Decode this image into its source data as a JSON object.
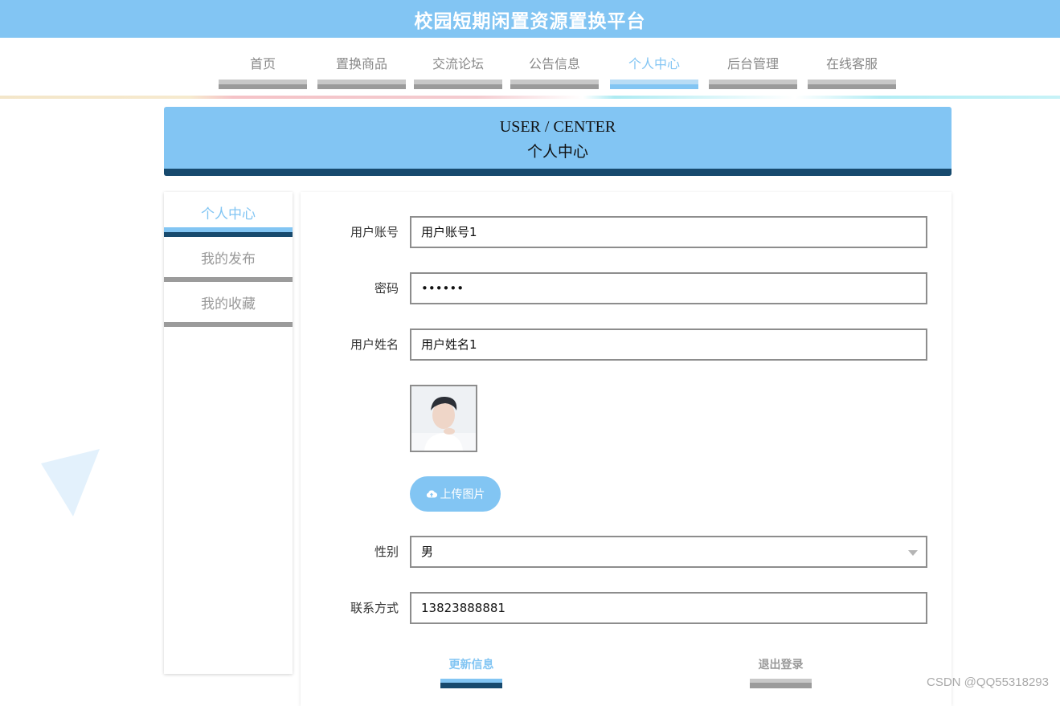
{
  "app": {
    "title": "校园短期闲置资源置换平台"
  },
  "nav": {
    "items": [
      {
        "label": "首页",
        "active": false
      },
      {
        "label": "置换商品",
        "active": false
      },
      {
        "label": "交流论坛",
        "active": false
      },
      {
        "label": "公告信息",
        "active": false
      },
      {
        "label": "个人中心",
        "active": true
      },
      {
        "label": "后台管理",
        "active": false
      },
      {
        "label": "在线客服",
        "active": false
      }
    ]
  },
  "header": {
    "title_en": "USER / CENTER",
    "title_cn": "个人中心"
  },
  "sidebar": {
    "items": [
      {
        "label": "个人中心",
        "active": true
      },
      {
        "label": "我的发布",
        "active": false
      },
      {
        "label": "我的收藏",
        "active": false
      }
    ]
  },
  "form": {
    "account": {
      "label": "用户账号",
      "value": "用户账号1"
    },
    "password": {
      "label": "密码",
      "value": "••••••"
    },
    "name": {
      "label": "用户姓名",
      "value": "用户姓名1"
    },
    "avatar": {
      "icon": "user-photo"
    },
    "upload": {
      "label": "上传图片",
      "icon": "cloud-upload-icon"
    },
    "gender": {
      "label": "性别",
      "value": "男"
    },
    "phone": {
      "label": "联系方式",
      "value": "13823888881"
    }
  },
  "actions": {
    "update_label": "更新信息",
    "logout_label": "退出登录"
  },
  "watermark": "CSDN @QQ55318293",
  "colors": {
    "accent": "#82c5f3",
    "dark": "#174a6e",
    "muted": "#999999"
  }
}
